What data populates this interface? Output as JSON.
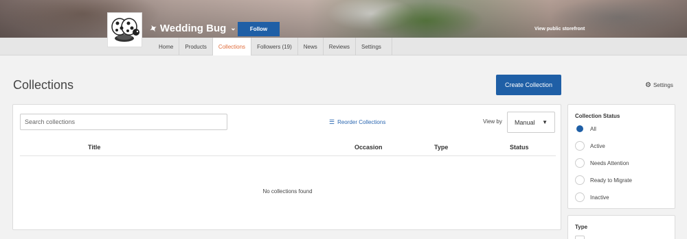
{
  "store": {
    "name": "Wedding Bug",
    "follow_label": "Follow",
    "storefront_label": "View public storefront"
  },
  "nav": {
    "tabs": [
      {
        "label": "Home"
      },
      {
        "label": "Products"
      },
      {
        "label": "Collections"
      },
      {
        "label": "Followers (19)"
      },
      {
        "label": "News"
      },
      {
        "label": "Reviews"
      },
      {
        "label": "Settings"
      }
    ],
    "active": "Collections"
  },
  "header": {
    "title": "Collections",
    "create_label": "Create Collection",
    "settings_label": "Settings"
  },
  "toolbar": {
    "search_placeholder": "Search collections",
    "reorder_label": "Reorder Collections",
    "viewby_label": "View by",
    "viewby_value": "Manual"
  },
  "table": {
    "columns": [
      "Title",
      "Occasion",
      "Type",
      "Status"
    ],
    "empty_message": "No collections found"
  },
  "sidebar": {
    "status_title": "Collection Status",
    "status_options": [
      {
        "label": "All",
        "checked": true
      },
      {
        "label": "Active",
        "checked": false
      },
      {
        "label": "Needs Attention",
        "checked": false
      },
      {
        "label": "Ready to Migrate",
        "checked": false
      },
      {
        "label": "Inactive",
        "checked": false
      }
    ],
    "type_title": "Type"
  },
  "colors": {
    "accent": "#1f5fa6",
    "active_tab": "#e06c3b",
    "link": "#2a66b0"
  },
  "icons": [
    "pin-icon",
    "chevron-down-icon",
    "gear-icon",
    "menu-icon",
    "caret-down-icon",
    "ladybug-logo"
  ]
}
